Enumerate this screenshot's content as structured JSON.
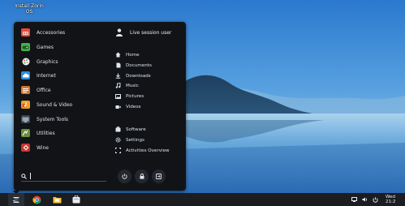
{
  "desktop": {
    "icon_label_line1": "Install Zorin",
    "icon_label_line2": "OS"
  },
  "menu": {
    "categories": [
      {
        "label": "Accessories",
        "icon": "accessories-icon",
        "color": "#e84a3c"
      },
      {
        "label": "Games",
        "icon": "games-icon",
        "color": "#43b24a"
      },
      {
        "label": "Graphics",
        "icon": "graphics-icon",
        "color": "#f2f2f2"
      },
      {
        "label": "Internet",
        "icon": "internet-icon",
        "color": "#2e8fe0"
      },
      {
        "label": "Office",
        "icon": "office-icon",
        "color": "#d9762a"
      },
      {
        "label": "Sound & Video",
        "icon": "sound-video-icon",
        "color": "#f0a21c"
      },
      {
        "label": "System Tools",
        "icon": "system-tools-icon",
        "color": "#3b4450"
      },
      {
        "label": "Utilities",
        "icon": "utilities-icon",
        "color": "#6a8e3a"
      },
      {
        "label": "Wine",
        "icon": "wine-icon",
        "color": "#c8332c"
      }
    ],
    "user": {
      "label": "Live session user",
      "icon": "user-icon"
    },
    "places": [
      {
        "label": "Home",
        "icon": "home-icon"
      },
      {
        "label": "Documents",
        "icon": "documents-icon"
      },
      {
        "label": "Downloads",
        "icon": "downloads-icon"
      },
      {
        "label": "Music",
        "icon": "music-icon"
      },
      {
        "label": "Pictures",
        "icon": "pictures-icon"
      },
      {
        "label": "Videos",
        "icon": "videos-icon"
      }
    ],
    "system": [
      {
        "label": "Software",
        "icon": "software-icon"
      },
      {
        "label": "Settings",
        "icon": "settings-icon"
      },
      {
        "label": "Activities Overview",
        "icon": "activities-icon"
      }
    ],
    "search": {
      "value": "",
      "icon": "search-icon"
    },
    "power_buttons": [
      {
        "icon": "power-icon"
      },
      {
        "icon": "lock-icon"
      },
      {
        "icon": "logout-icon"
      }
    ]
  },
  "taskbar": {
    "apps": [
      {
        "icon": "zorin-menu-icon"
      },
      {
        "icon": "chrome-icon"
      },
      {
        "icon": "files-icon"
      },
      {
        "icon": "software-store-icon"
      }
    ],
    "tray": [
      {
        "icon": "screen-icon"
      },
      {
        "icon": "volume-icon"
      },
      {
        "icon": "power-status-icon"
      }
    ],
    "clock": "Wed 21:2"
  },
  "colors": {
    "menu_bg": "#111316",
    "taskbar_bg": "#1b1d21",
    "sky_top": "#2d7fd2",
    "water": "#4f97cf"
  }
}
